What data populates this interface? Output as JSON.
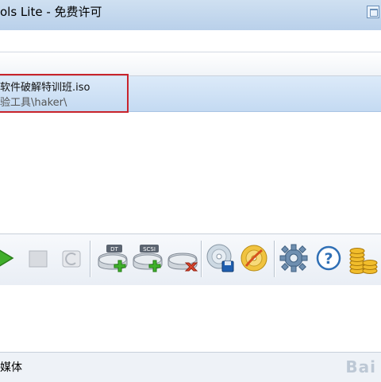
{
  "window": {
    "title": "ols Lite - 免费许可"
  },
  "image_list": {
    "items": [
      {
        "name": "软件破解特训班.iso",
        "path": "验工具\\haker\\"
      }
    ]
  },
  "toolbar": {
    "buttons": [
      {
        "icon": "play-icon"
      },
      {
        "icon": "stop-icon"
      },
      {
        "icon": "refresh-icon"
      },
      {
        "icon": "add-dt-drive-icon",
        "badge": "DT"
      },
      {
        "icon": "add-scsi-drive-icon",
        "badge": "SCSI"
      },
      {
        "icon": "remove-drive-icon"
      },
      {
        "icon": "write-disc-icon"
      },
      {
        "icon": "burn-disc-icon"
      },
      {
        "icon": "settings-gear-icon"
      },
      {
        "icon": "help-icon",
        "label": "?"
      },
      {
        "icon": "coins-icon"
      }
    ]
  },
  "status": {
    "text": "媒体"
  },
  "watermark": {
    "text": "Bai"
  }
}
